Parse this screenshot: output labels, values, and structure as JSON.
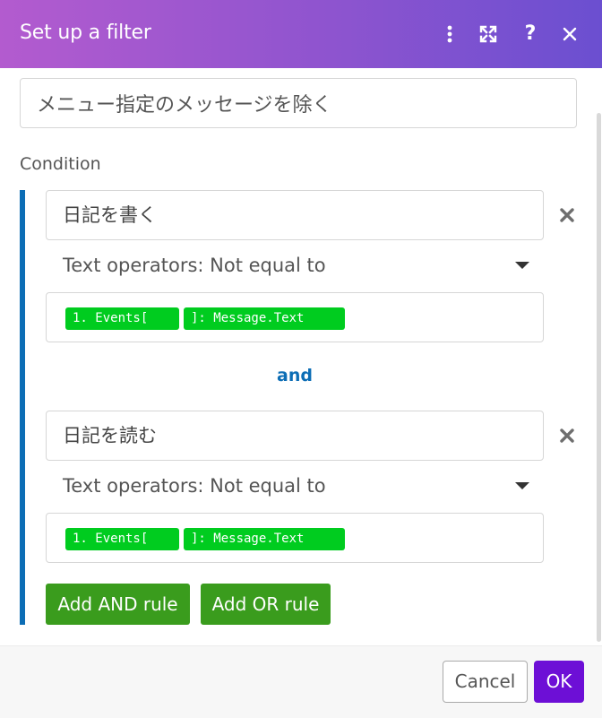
{
  "header": {
    "title": "Set up a filter",
    "actions": [
      "more-vertical-icon",
      "expand-icon",
      "help-icon",
      "close-icon"
    ],
    "help_glyph": "?"
  },
  "filter_name": {
    "value": "メニュー指定のメッセージを除く"
  },
  "condition": {
    "label": "Condition",
    "connector": "and",
    "rules": [
      {
        "value": "日記を書く",
        "operator": "Text operators: Not equal to",
        "operand_pills": [
          "1. Events[",
          "]: Message.Text"
        ]
      },
      {
        "value": "日記を読む",
        "operator": "Text operators: Not equal to",
        "operand_pills": [
          "1. Events[",
          "]: Message.Text"
        ]
      }
    ],
    "add_and_label": "Add AND rule",
    "add_or_label": "Add OR rule"
  },
  "footer": {
    "cancel_label": "Cancel",
    "ok_label": "OK"
  },
  "colors": {
    "header_gradient_start": "#b35bcf",
    "header_gradient_end": "#6b4fd0",
    "condition_accent": "#0c6db5",
    "pill": "#00cc1f",
    "rule_button": "#3a9c1d",
    "ok_button": "#6d0fd6"
  }
}
